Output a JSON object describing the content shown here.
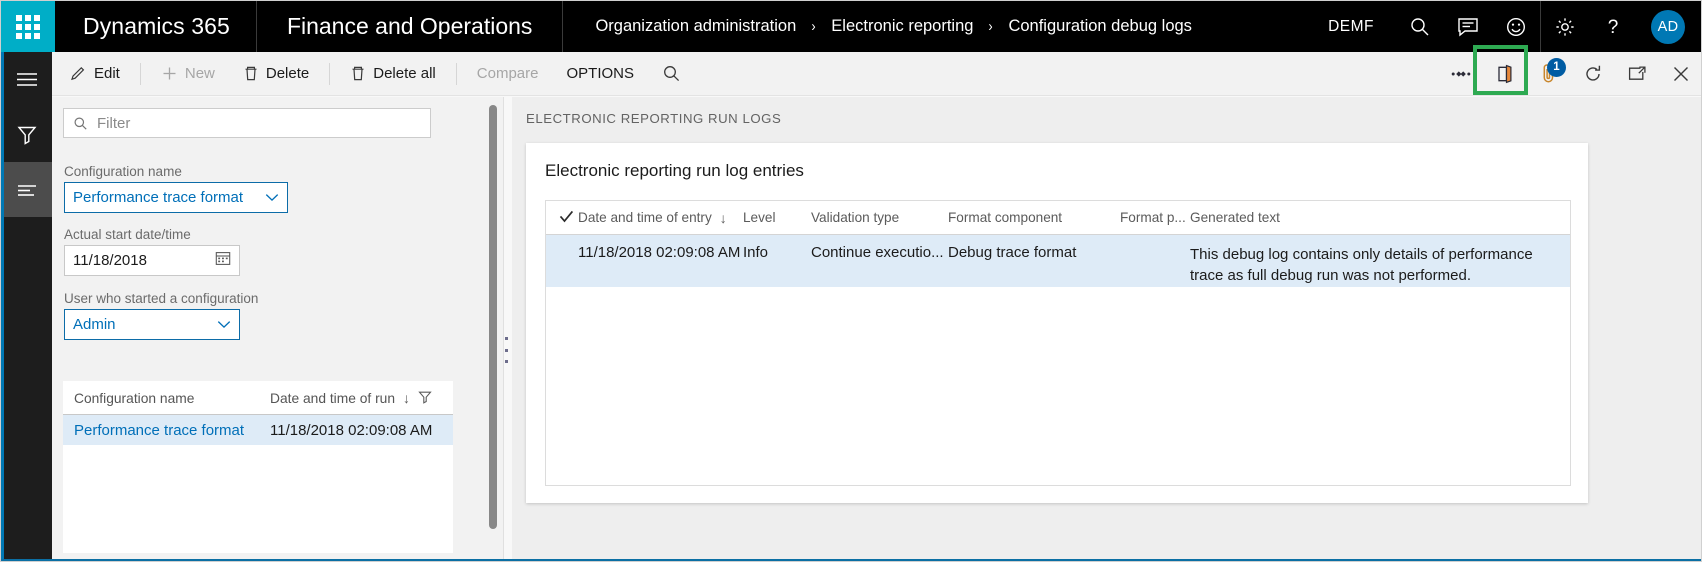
{
  "topbar": {
    "waffle_label": "app-launcher",
    "brand": "Dynamics 365",
    "module": "Finance and Operations",
    "breadcrumb": [
      {
        "label": "Organization administration"
      },
      {
        "label": "Electronic reporting"
      },
      {
        "label": "Configuration debug logs"
      }
    ],
    "separator": "›",
    "company": "DEMF",
    "icons": [
      {
        "name": "search-icon"
      },
      {
        "name": "message-icon"
      },
      {
        "name": "feedback-smiley-icon"
      },
      {
        "name": "settings-gear-icon"
      },
      {
        "name": "help-question-icon"
      }
    ],
    "avatar_initials": "AD"
  },
  "actionpane": {
    "buttons": [
      {
        "label": "Edit",
        "icon": "pencil-icon",
        "disabled": false
      },
      {
        "label": "New",
        "icon": "plus-icon",
        "disabled": true
      },
      {
        "label": "Delete",
        "icon": "trash-icon",
        "disabled": false
      },
      {
        "label": "Delete all",
        "icon": "trash-icon",
        "disabled": false
      },
      {
        "label": "Compare",
        "icon": "none",
        "disabled": true
      },
      {
        "label": "OPTIONS",
        "icon": "none",
        "disabled": false
      }
    ],
    "search_icon": "search-icon",
    "right_icons": [
      {
        "name": "relationships-icon"
      },
      {
        "name": "office-export-icon"
      },
      {
        "name": "attachment-paperclip-icon",
        "badge": "1",
        "highlighted": true
      },
      {
        "name": "refresh-icon"
      },
      {
        "name": "popout-window-icon"
      },
      {
        "name": "close-icon"
      }
    ],
    "highlight_color": "#2eaa52",
    "badge_color": "#005ca3"
  },
  "leftrail": {
    "items": [
      {
        "name": "navigation-menu-icon",
        "active": false
      },
      {
        "name": "filter-funnel-icon",
        "active": false
      },
      {
        "name": "list-lines-icon",
        "active": true
      }
    ],
    "accent_color": "#0078b4"
  },
  "filterpane": {
    "filter_placeholder": "Filter",
    "filter_value": "",
    "fields": [
      {
        "label": "Configuration name",
        "value": "Performance trace format",
        "type": "combo"
      },
      {
        "label": "Actual start date/time",
        "value": "11/18/2018",
        "type": "date"
      },
      {
        "label": "User who started a configuration",
        "value": "Admin",
        "type": "combo"
      }
    ],
    "grid": {
      "columns": [
        "Configuration name",
        "Date and time of run"
      ],
      "sort_indicator": "↓",
      "filter_icon": "filter-funnel-icon",
      "rows": [
        {
          "configuration_name": "Performance trace format",
          "date_and_time_of_run": "11/18/2018 02:09:08 AM",
          "selected": true
        }
      ]
    }
  },
  "main": {
    "caption": "ELECTRONIC REPORTING RUN LOGS",
    "card_title": "Electronic reporting run log entries",
    "grid": {
      "columns": [
        "Date and time of entry",
        "Level",
        "Validation type",
        "Format component",
        "Format p...",
        "Generated text"
      ],
      "sort_indicator": "↓",
      "select_all_icon": "checkmark-icon",
      "rows": [
        {
          "date_and_time_of_entry": "11/18/2018 02:09:08 AM",
          "level": "Info",
          "validation_type": "Continue executio...",
          "format_component": "Debug trace format",
          "format_path": "",
          "generated_text": "This debug log contains only details of performance trace as full debug run was not performed.",
          "selected": true
        }
      ]
    }
  },
  "colors": {
    "accent_teal": "#00aec7",
    "link_blue": "#006fb8",
    "selected_row": "#deebf7",
    "status_blue": "#0b6fa4"
  }
}
